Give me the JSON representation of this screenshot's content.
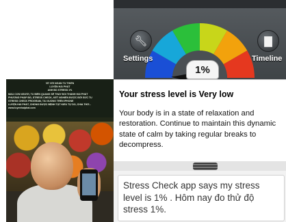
{
  "photo": {
    "title_lines": [
      "VỀ VỚI NGÀN TU THIỀN",
      "LUYỆN HẢI PHÁT",
      "ANH BỐ STRESS 1%"
    ],
    "body_lines": [
      "MẦU CON NGƯỜI, TU BIÊN QUANG SẼ THAY ĐỔI THÀNH HẢI PHÁT",
      "PHƯƠNG PHÁP BG, STRESS CHECK, KẾT NGHIÊN ĐƯỢC BỞI SỨC TU",
      "STRESS CHECK PROGRAM, TẢI XUỐNG TRÊN IPHONE",
      "LUYỆN HẢI PHÁT, CHỐNG ĐƯỢC BỆNH TẬT KIỂU TỰ DO, CHIA THỞ...",
      "www.luyenhaiphat.com"
    ]
  },
  "app": {
    "settings_label": "Settings",
    "timeline_label": "Timeline",
    "settings_icon": "wrench-icon",
    "timeline_icon": "bar-chart-icon",
    "stress_value": "1%",
    "stress_level_fraction": 0.01,
    "headline": "Your stress level is Very low",
    "body": "Your body is in a state of relaxation and restoration. Continue to maintain this dynamic state of calm by taking regular breaks to decompress.",
    "gauge_colors": [
      "#1a4fd6",
      "#17a7d9",
      "#2bbf3a",
      "#c8d61a",
      "#f2a20c",
      "#e5381f"
    ]
  },
  "post": {
    "text": "Stress Check app says my stress level is 1% . Hôm nay đo thử độ stress 1%."
  }
}
